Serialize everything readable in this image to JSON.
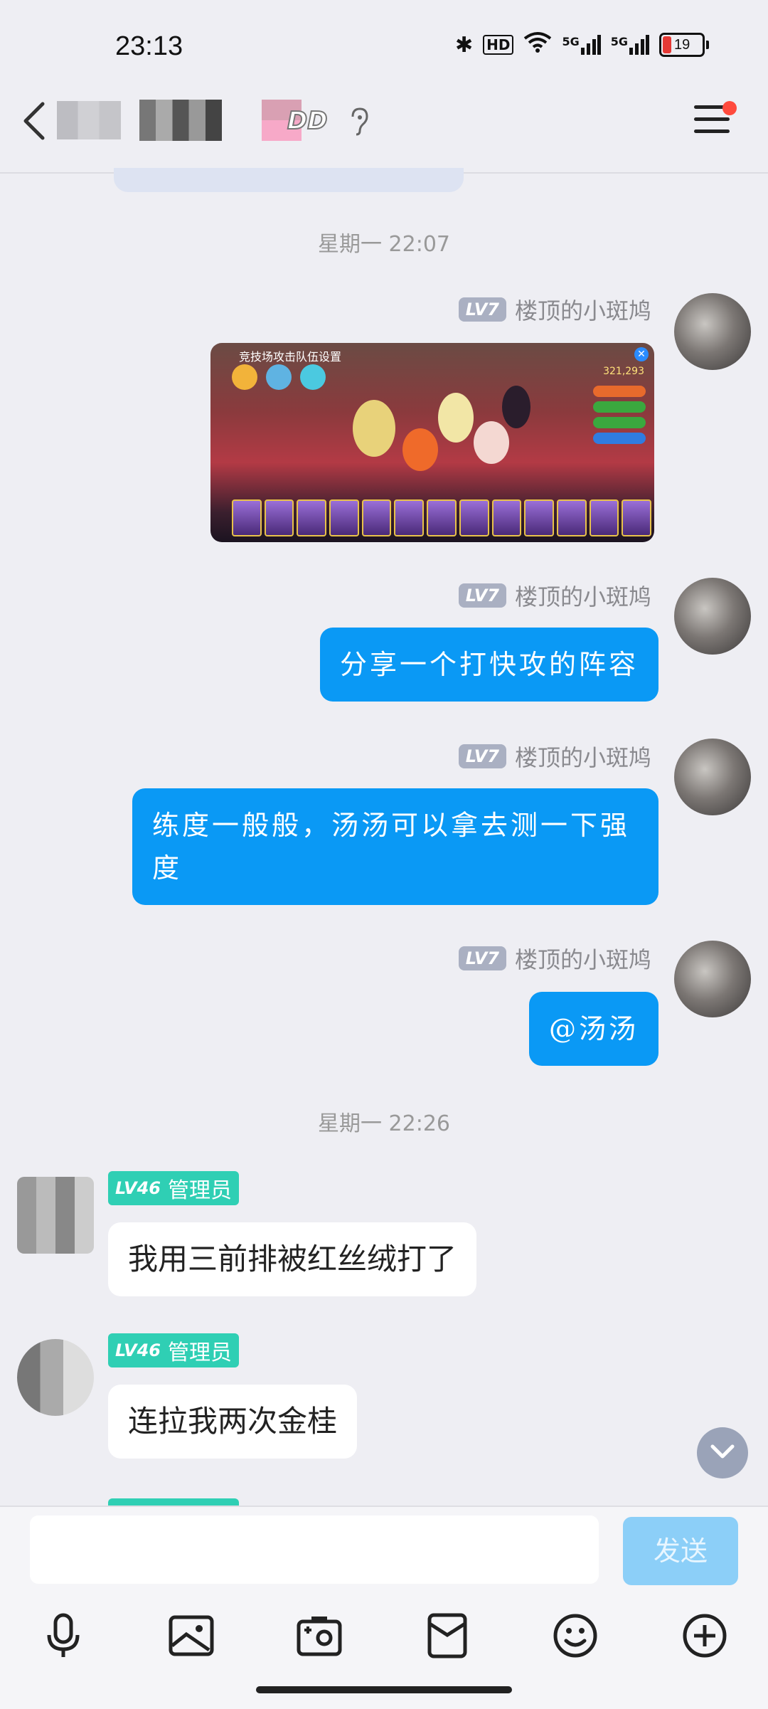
{
  "status_bar": {
    "time": "23:13",
    "hd_label": "HD",
    "network_1": "5G",
    "network_2": "5G",
    "battery": "19"
  },
  "header": {
    "dd_label": "DD"
  },
  "timestamps": {
    "first": "星期一 22:07",
    "second": "星期一 22:26"
  },
  "messages_right": [
    {
      "level": "LV7",
      "sender": "楼顶的小斑鸠",
      "type": "image",
      "image_title": "竞技场攻击队伍设置",
      "image_gold": "321,293"
    },
    {
      "level": "LV7",
      "sender": "楼顶的小斑鸠",
      "text": "分享一个打快攻的阵容"
    },
    {
      "level": "LV7",
      "sender": "楼顶的小斑鸠",
      "text": "练度一般般，汤汤可以拿去测一下强度"
    },
    {
      "level": "LV7",
      "sender": "楼顶的小斑鸠",
      "text": "@汤汤"
    }
  ],
  "messages_left": [
    {
      "level": "LV46",
      "role": "管理员",
      "text": "我用三前排被红丝绒打了"
    },
    {
      "level": "LV46",
      "role": "管理员",
      "text": "连拉我两次金桂"
    }
  ],
  "composer": {
    "placeholder": "",
    "send_label": "发送"
  },
  "toolbar_icons": [
    "microphone-icon",
    "image-icon",
    "camera-icon",
    "red-packet-icon",
    "emoji-icon",
    "plus-icon"
  ],
  "colors": {
    "bubble_blue": "#0a99f5",
    "admin_badge": "#2fcfb4",
    "level_badge": "#aab0c2"
  }
}
